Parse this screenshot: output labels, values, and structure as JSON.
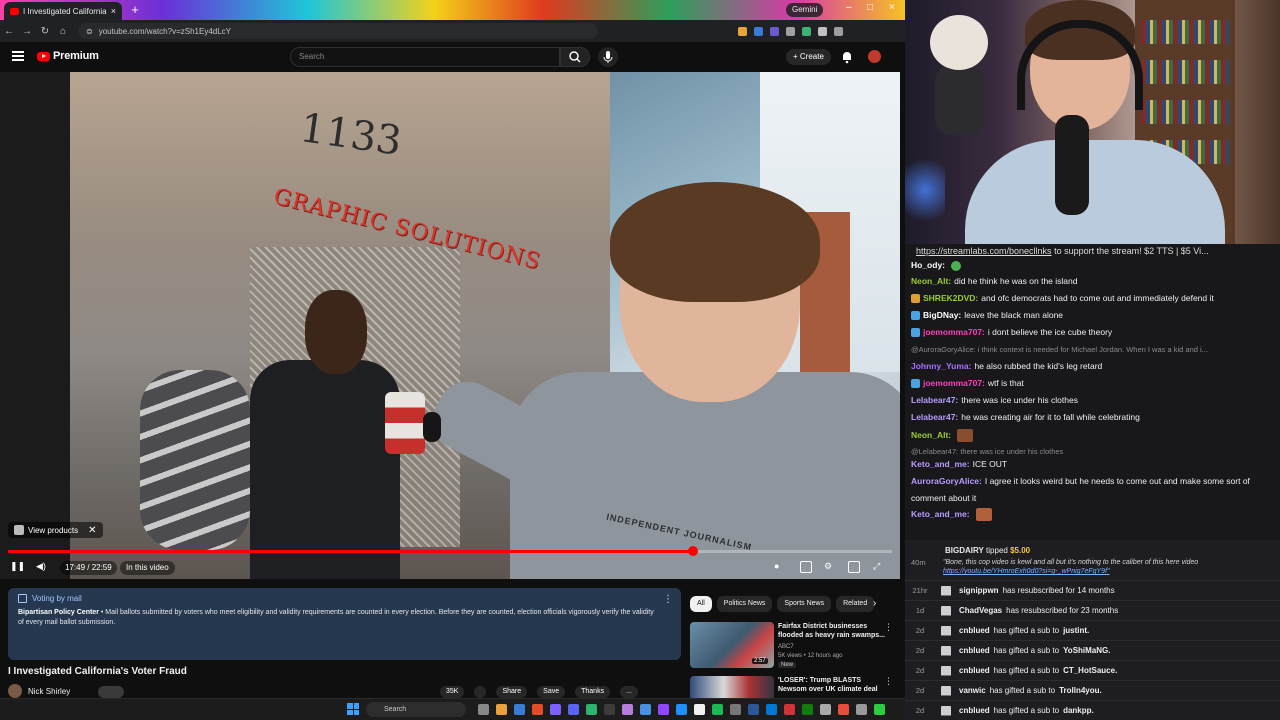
{
  "browser": {
    "tab_title": "I Investigated California's V",
    "tab_close": "×",
    "new_tab": "+",
    "gemini_label": "Gemini",
    "url": "youtube.com/watch?v=zSh1Ey4dLcY",
    "window_controls": [
      "–",
      "□",
      "×"
    ]
  },
  "youtube_header": {
    "logo_text": "Premium",
    "search_placeholder": "Search",
    "create_label": "+ Create"
  },
  "video": {
    "sign_number": "1133",
    "sign_text": "GRAPHIC SOLUTIONS",
    "hoodie_text": "INDEPENDENT JOURNALISM",
    "view_products_label": "View products",
    "time_display": "17:49 / 22:59",
    "in_this_video_label": "In this video",
    "progress_fraction": 0.775
  },
  "info_panel": {
    "heading": "Voting by mail",
    "org": "Bipartisan Policy Center",
    "body": " • Mail ballots submitted by voters who meet eligibility and validity requirements are counted in every election. Before they are counted, election officials vigorously verify the validity of every mail ballot submission."
  },
  "video_title": "I Investigated California's Voter Fraud",
  "channel_name": "Nick Shirley",
  "actions": [
    "35K",
    "",
    "Share",
    "Save",
    "Thanks",
    "..."
  ],
  "chips": [
    "All",
    "Politics News",
    "Sports News",
    "Related"
  ],
  "recommendations": [
    {
      "title": "Fairfax District businesses flooded as heavy rain swamps...",
      "channel": "ABC7",
      "meta": "5K views • 12 hours ago",
      "duration": "2:57",
      "badge": "New"
    },
    {
      "title": "'LOSER': Trump BLASTS Newsom over UK climate deal",
      "channel": "",
      "meta": "",
      "duration": "",
      "badge": ""
    }
  ],
  "taskbar": {
    "search_label": "Search"
  },
  "chat": {
    "banner_link": "https://streamlabs.com/bonecllnks",
    "banner_rest": " to support the stream! $2 TTS | $5 Vi...",
    "messages": [
      {
        "user": "Ho_ody:",
        "text": "",
        "color": "#ffffff",
        "badge": "",
        "emote": "#4caf50"
      },
      {
        "user": "Neon_Alt:",
        "text": "did he think he was on the island",
        "color": "#9acd32",
        "badge": ""
      },
      {
        "user": "SHREK2DVD:",
        "text": "and ofc democrats had to come out and immediately defend it",
        "color": "#9acd32",
        "badge": "#e0a030"
      },
      {
        "user": "BigDNay:",
        "text": "leave the black man alone",
        "color": "#ffffff",
        "badge": "#4aa3e0"
      },
      {
        "user": "joemomma707:",
        "text": "i dont believe the ice cube theory",
        "color": "#ff3fbf",
        "badge": "#4aa3e0"
      },
      {
        "user": "",
        "text": "@AuroraGoryAlice: i think context is needed for Michael Jordan. When I was a kid and i...",
        "color": "#8a8a8f",
        "badge": "",
        "reply": true
      },
      {
        "user": "Johnny_Yuma:",
        "text": "he also rubbed the kid's leg retard",
        "color": "#a770ff",
        "badge": ""
      },
      {
        "user": "joemomma707:",
        "text": "wtf is that",
        "color": "#ff3fbf",
        "badge": "#4aa3e0"
      },
      {
        "user": "Lelabear47:",
        "text": "there was ice under his clothes",
        "color": "#b89cff",
        "badge": ""
      },
      {
        "user": "Lelabear47:",
        "text": "he was creating air for it to fall while celebrating",
        "color": "#b89cff",
        "badge": ""
      },
      {
        "user": "Neon_Alt:",
        "text": "",
        "color": "#9acd32",
        "badge": "",
        "emote_sq": "#8a4e2e"
      },
      {
        "user": "",
        "text": "@Lelabear47: there was ice under his clothes",
        "color": "#8a8a8f",
        "badge": "",
        "reply": true
      },
      {
        "user": "Keto_and_me:",
        "text": "ICE OUT",
        "color": "#b89cff",
        "badge": ""
      },
      {
        "user": "AuroraGoryAlice:",
        "text": "I agree it looks weird but he needs to come out and make some sort of",
        "color": "#b89cff",
        "badge": ""
      },
      {
        "user": "",
        "text": "comment about it",
        "color": "#efeff1",
        "badge": "",
        "cont": true
      },
      {
        "user": "Keto_and_me:",
        "text": "",
        "color": "#b89cff",
        "badge": "",
        "emote_sq": "#b0603a"
      }
    ]
  },
  "events": {
    "tip": {
      "user": "BIGDAIRY",
      "action": " tipped ",
      "amount": "$5.00",
      "message": "\"Bone, this cop video is kewl and all but it's nothing to the caliber of this here video",
      "link": "https://youtu.be/YHmroExh0d0?si=g-_wPnig7eFgY9f\""
    },
    "rows": [
      {
        "age": "21hr",
        "user": "signippwn",
        "text": "has resubscribed for 14 months",
        "target": ""
      },
      {
        "age": "1d",
        "user": "ChadVegas",
        "text": "has resubscribed for 23 months",
        "target": ""
      },
      {
        "age": "2d",
        "user": "cnblued",
        "text": "has gifted a sub to",
        "target": "justint."
      },
      {
        "age": "2d",
        "user": "cnblued",
        "text": "has gifted a sub to",
        "target": "YoShiMaNG."
      },
      {
        "age": "2d",
        "user": "cnblued",
        "text": "has gifted a sub to",
        "target": "CT_HotSauce."
      },
      {
        "age": "2d",
        "user": "vanwic",
        "text": "has gifted a sub to",
        "target": "Trolln4you."
      },
      {
        "age": "2d",
        "user": "cnblued",
        "text": "has gifted a sub to",
        "target": "dankpp."
      }
    ],
    "tip_age": "40m"
  }
}
